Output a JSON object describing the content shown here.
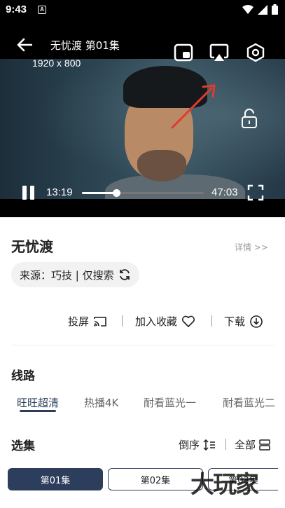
{
  "status_bar": {
    "time": "9:43",
    "notification": "A"
  },
  "player": {
    "title": "无忧渡 第01集",
    "resolution": "1920 x 800",
    "current_time": "13:19",
    "duration": "47:03",
    "progress": 0.28
  },
  "info": {
    "title": "无忧渡",
    "details_link": "详情 >>",
    "source_label": "来源：巧技 | 仅搜索",
    "actions": {
      "cast": "投屏",
      "favorite": "加入收藏",
      "download": "下载"
    }
  },
  "routes": {
    "heading": "线路",
    "items": [
      "旺旺超清",
      "热播4K",
      "耐看蓝光一",
      "耐看蓝光二"
    ],
    "active_index": 0
  },
  "episodes": {
    "heading": "选集",
    "sort_label": "倒序",
    "all_label": "全部",
    "items": [
      "第01集",
      "第02集",
      "第03集"
    ],
    "active_index": 0
  },
  "watermark": "大玩家",
  "colors": {
    "accent": "#2d3e5c",
    "player_bg": "#000000"
  }
}
